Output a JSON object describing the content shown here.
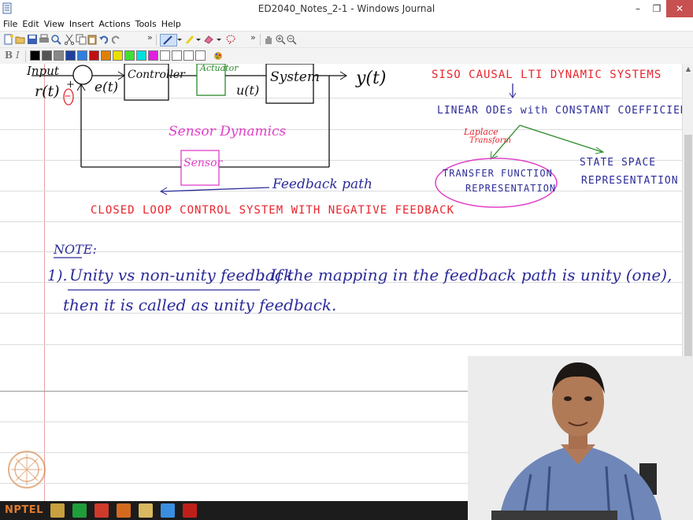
{
  "window": {
    "title": "ED2040_Notes_2-1 - Windows Journal",
    "controls": {
      "minimize": "–",
      "maximize": "❐",
      "close": "✕"
    }
  },
  "menu": [
    "File",
    "Edit",
    "View",
    "Insert",
    "Actions",
    "Tools",
    "Help"
  ],
  "toolbar": {
    "overflow_chevron": "»",
    "swatches": [
      "#000000",
      "#555555",
      "#888888",
      "#1f3fa0",
      "#2f7fe0",
      "#c01010",
      "#e08000",
      "#e8e000",
      "#40e030",
      "#00e0e0",
      "#e020e0",
      "#ffffff",
      "#ffffff",
      "#ffffff",
      "#ffffff"
    ]
  },
  "accent": {
    "close_button": "#c75050",
    "taskbar": "#1c1c1c",
    "margin_line": "#e9a0a0"
  },
  "diagram": {
    "input_label": "Input",
    "r_label": "r(t)",
    "plus_sign": "+",
    "minus_sign": "−",
    "e_label": "e(t)",
    "controller_label": "Controller",
    "actuator_label": "Actuator",
    "u_label": "u(t)",
    "system_label": "System",
    "y_label": "y(t)",
    "sensor_dynamics_label": "Sensor Dynamics",
    "sensor_label": "Sensor",
    "feedback_path_label": "Feedback path",
    "caption": "CLOSED LOOP CONTROL SYSTEM WITH NEGATIVE FEEDBACK"
  },
  "right_notes": {
    "siso": "SISO CAUSAL LTI DYNAMIC SYSTEMS",
    "linear_odes": "LINEAR ODEs with CONSTANT COEFFICIENTS",
    "laplace_1": "Laplace",
    "laplace_2": "Transform",
    "tf_line1": "TRANSFER FUNCTION",
    "tf_line2": "REPRESENTATION",
    "ss_line1": "STATE SPACE",
    "ss_line2": "REPRESENTATION"
  },
  "note": {
    "heading": "NOTE:",
    "item_number": "1).",
    "item_title": "Unity vs non-unity feedback",
    "item_text_1": ": If the mapping in the feedback path is unity (one),",
    "item_text_2": "then it is called as unity feedback."
  },
  "branding": {
    "nptel": "NPTEL"
  },
  "taskbar_icons": [
    {
      "name": "explorer-icon",
      "color": "#c8a040"
    },
    {
      "name": "app-green-icon",
      "color": "#1f9e3a"
    },
    {
      "name": "app-red-icon",
      "color": "#d03a2a"
    },
    {
      "name": "app-orange-icon",
      "color": "#d46a20"
    },
    {
      "name": "folder-icon",
      "color": "#d8b860"
    },
    {
      "name": "chrome-icon",
      "color": "#3a8ee0"
    },
    {
      "name": "pdf-icon",
      "color": "#c0201a"
    }
  ]
}
